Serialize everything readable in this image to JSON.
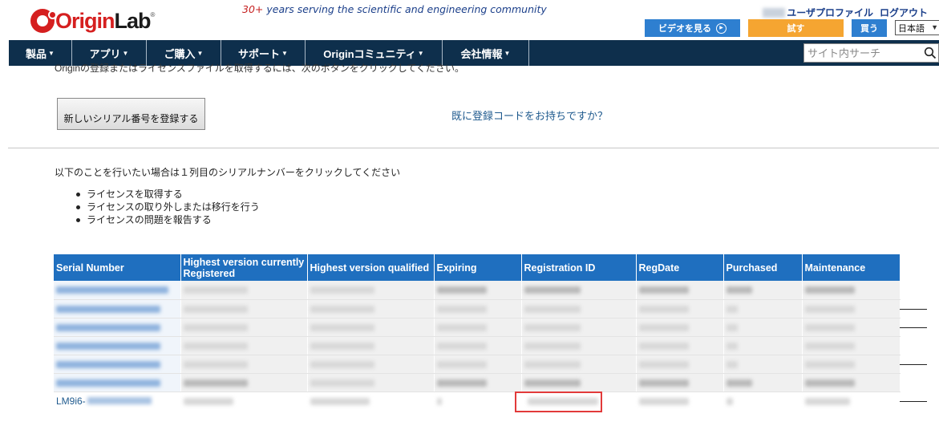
{
  "header": {
    "logo": {
      "part1": "Origin",
      "part2": "Lab",
      "tm": "®"
    },
    "tagline": {
      "years": "30+",
      "rest": " years serving the scientific and engineering community"
    },
    "user_profile": "ユーザプロファイル",
    "logout": "ログアウト",
    "video_button": "ビデオを見る",
    "try_button": "試す",
    "buy_button": "買う",
    "language": "日本語"
  },
  "nav": {
    "items": [
      {
        "label": "製品"
      },
      {
        "label": "アプリ"
      },
      {
        "label": "ご購入"
      },
      {
        "label": "サポート"
      },
      {
        "label": "Originコミュニティ"
      },
      {
        "label": "会社情報"
      }
    ],
    "search_placeholder": "サイト内サーチ"
  },
  "content": {
    "cut_text": "Originの登録またはライセンスファイルを取得するには、次のボタンをクリックしてください。",
    "register_button": "新しいシリアル番号を登録する",
    "have_code_link": "既に登録コードをお持ちですか？",
    "instruction": "以下のことを行いたい場合は１列目のシリアルナンバーをクリックしてください",
    "bullets": [
      "ライセンスを取得する",
      "ライセンスの取り外しまたは移行を行う",
      "ライセンスの問題を報告する"
    ]
  },
  "table": {
    "headers": [
      "Serial Number",
      "Highest version currently Registered",
      "Highest version qualified",
      "Expiring",
      "Registration ID",
      "RegDate",
      "Purchased",
      "Maintenance"
    ],
    "rows": [
      [
        "",
        "",
        "",
        "",
        "",
        "",
        "",
        ""
      ],
      [
        "",
        "",
        "",
        "",
        "",
        "",
        "",
        ""
      ],
      [
        "",
        "",
        "",
        "",
        "",
        "",
        "",
        ""
      ],
      [
        "",
        "",
        "",
        "",
        "",
        "",
        "",
        ""
      ],
      [
        "",
        "",
        "",
        "",
        "",
        "",
        "",
        ""
      ],
      [
        "",
        "",
        "",
        "",
        "",
        "",
        "",
        ""
      ]
    ],
    "last_row_serial_prefix": "LM9i6-"
  },
  "colors": {
    "brand_red": "#d51f1f",
    "nav_bg": "#0e2f4c",
    "table_header": "#1f6fbf",
    "link": "#1f5a8e",
    "try_orange": "#f5a531",
    "highlight": "#e23a3a"
  }
}
